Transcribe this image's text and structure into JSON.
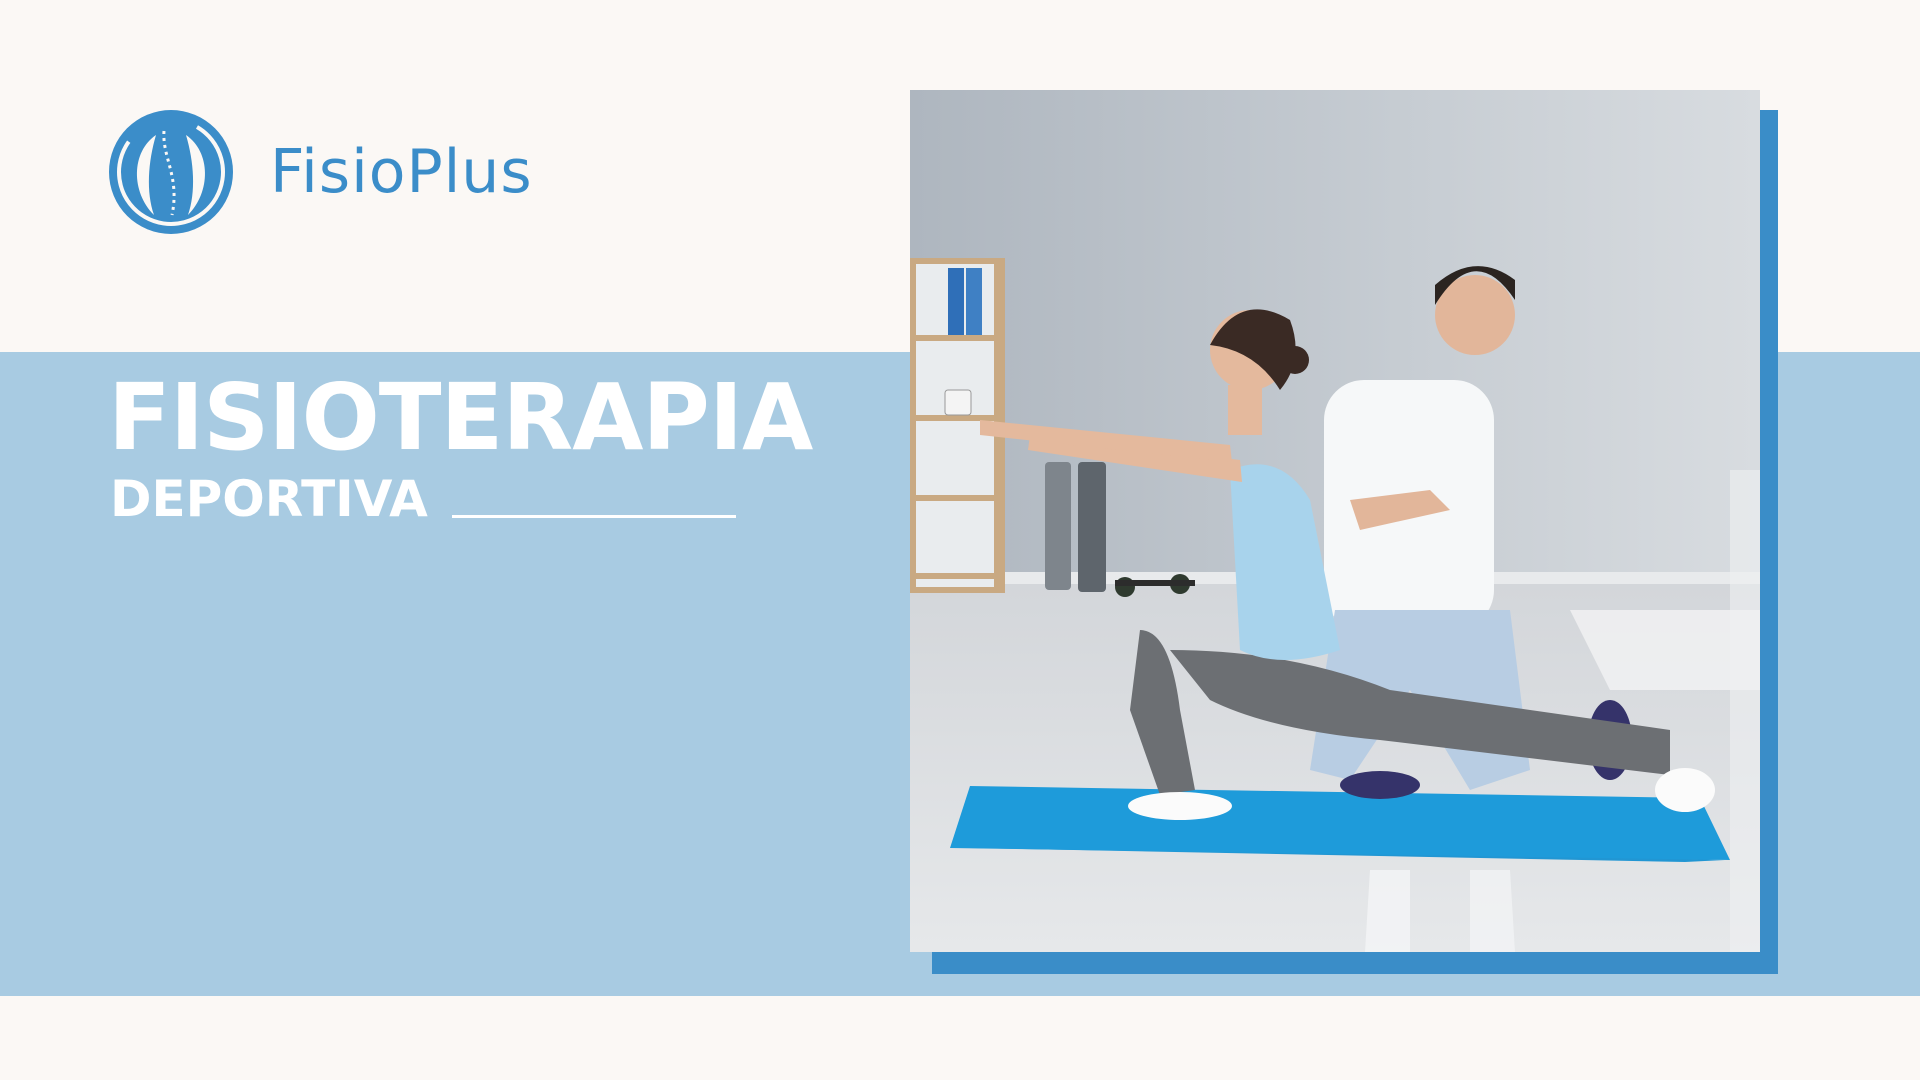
{
  "brand": {
    "name": "FisioPlus",
    "logo_icon": "spine-leaf-icon",
    "color": "#3B8DC9"
  },
  "hero": {
    "title": "FISIOTERAPIA",
    "subtitle": "DEPORTIVA"
  },
  "photo": {
    "description_icon": "physiotherapy-photo"
  },
  "colors": {
    "background": "#FBF8F5",
    "band": "#A8CBE2",
    "accent": "#3A8DC8",
    "text_on_band": "#FFFFFF"
  }
}
